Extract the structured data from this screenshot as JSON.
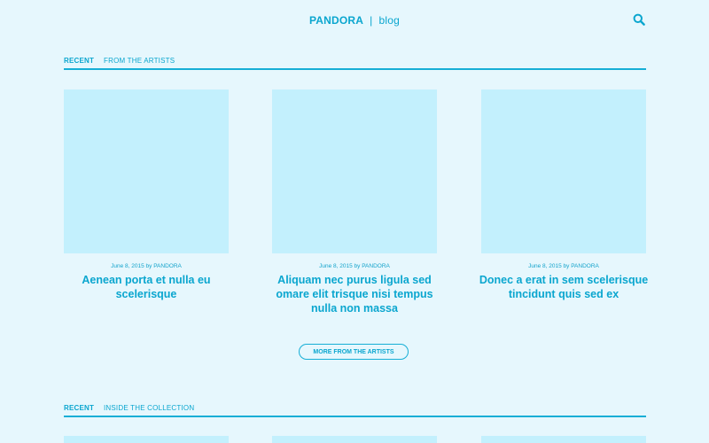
{
  "header": {
    "brand": "PANDORA",
    "separator": "|",
    "section": "blog",
    "search_icon": "search-icon"
  },
  "section1": {
    "tab_active": "RECENT",
    "tab_secondary": "FROM THE ARTISTS",
    "posts": [
      {
        "meta": "June 8, 2015 by PANDORA",
        "title": "Aenean porta et nulla eu scelerisque"
      },
      {
        "meta": "June 8, 2015 by PANDORA",
        "title": "Aliquam nec purus ligula sed omare elit trisque nisi tempus nulla non massa"
      },
      {
        "meta": "June 8, 2015 by PANDORA",
        "title": "Donec a erat in sem scelerisque tincidunt quis sed ex"
      }
    ],
    "more_label": "MORE FROM THE ARTISTS"
  },
  "section2": {
    "tab_active": "RECENT",
    "tab_secondary": "INSIDE THE COLLECTION"
  },
  "colors": {
    "background": "#e6f7fd",
    "accent": "#0aa6cf",
    "placeholder": "#c3f0fd"
  }
}
